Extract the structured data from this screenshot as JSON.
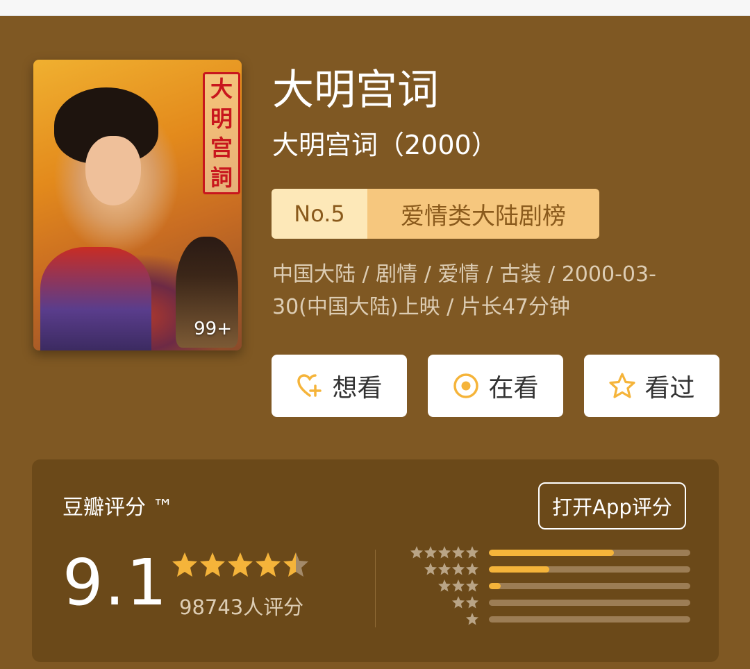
{
  "movie": {
    "title": "大明宫词",
    "subtitle": "大明宫词（2000）",
    "poster_title_chars": [
      "大",
      "明",
      "宫",
      "詞"
    ],
    "poster_count": "99+",
    "rank_no": "No.5",
    "rank_name": "爱情类大陆剧榜",
    "meta": "中国大陆 / 剧情 / 爱情 / 古装 / 2000-03-30(中国大陆)上映 / 片长47分钟"
  },
  "actions": [
    {
      "label": "想看",
      "icon": "heart-plus-icon"
    },
    {
      "label": "在看",
      "icon": "target-circle-icon"
    },
    {
      "label": "看过",
      "icon": "star-outline-icon"
    }
  ],
  "rating": {
    "label": "豆瓣评分 ™",
    "open_app": "打开App评分",
    "score": "9.1",
    "stars_value": 4.5,
    "votes": "98743人评分",
    "distribution": [
      {
        "stars": 5,
        "fraction": 0.62
      },
      {
        "stars": 4,
        "fraction": 0.3
      },
      {
        "stars": 3,
        "fraction": 0.06
      },
      {
        "stars": 2,
        "fraction": 0.0
      },
      {
        "stars": 1,
        "fraction": 0.0
      }
    ]
  },
  "colors": {
    "background": "#7f5823",
    "panel": "#6b4919",
    "accent": "#f5b43a",
    "rank_bg": "#f6c77e"
  }
}
